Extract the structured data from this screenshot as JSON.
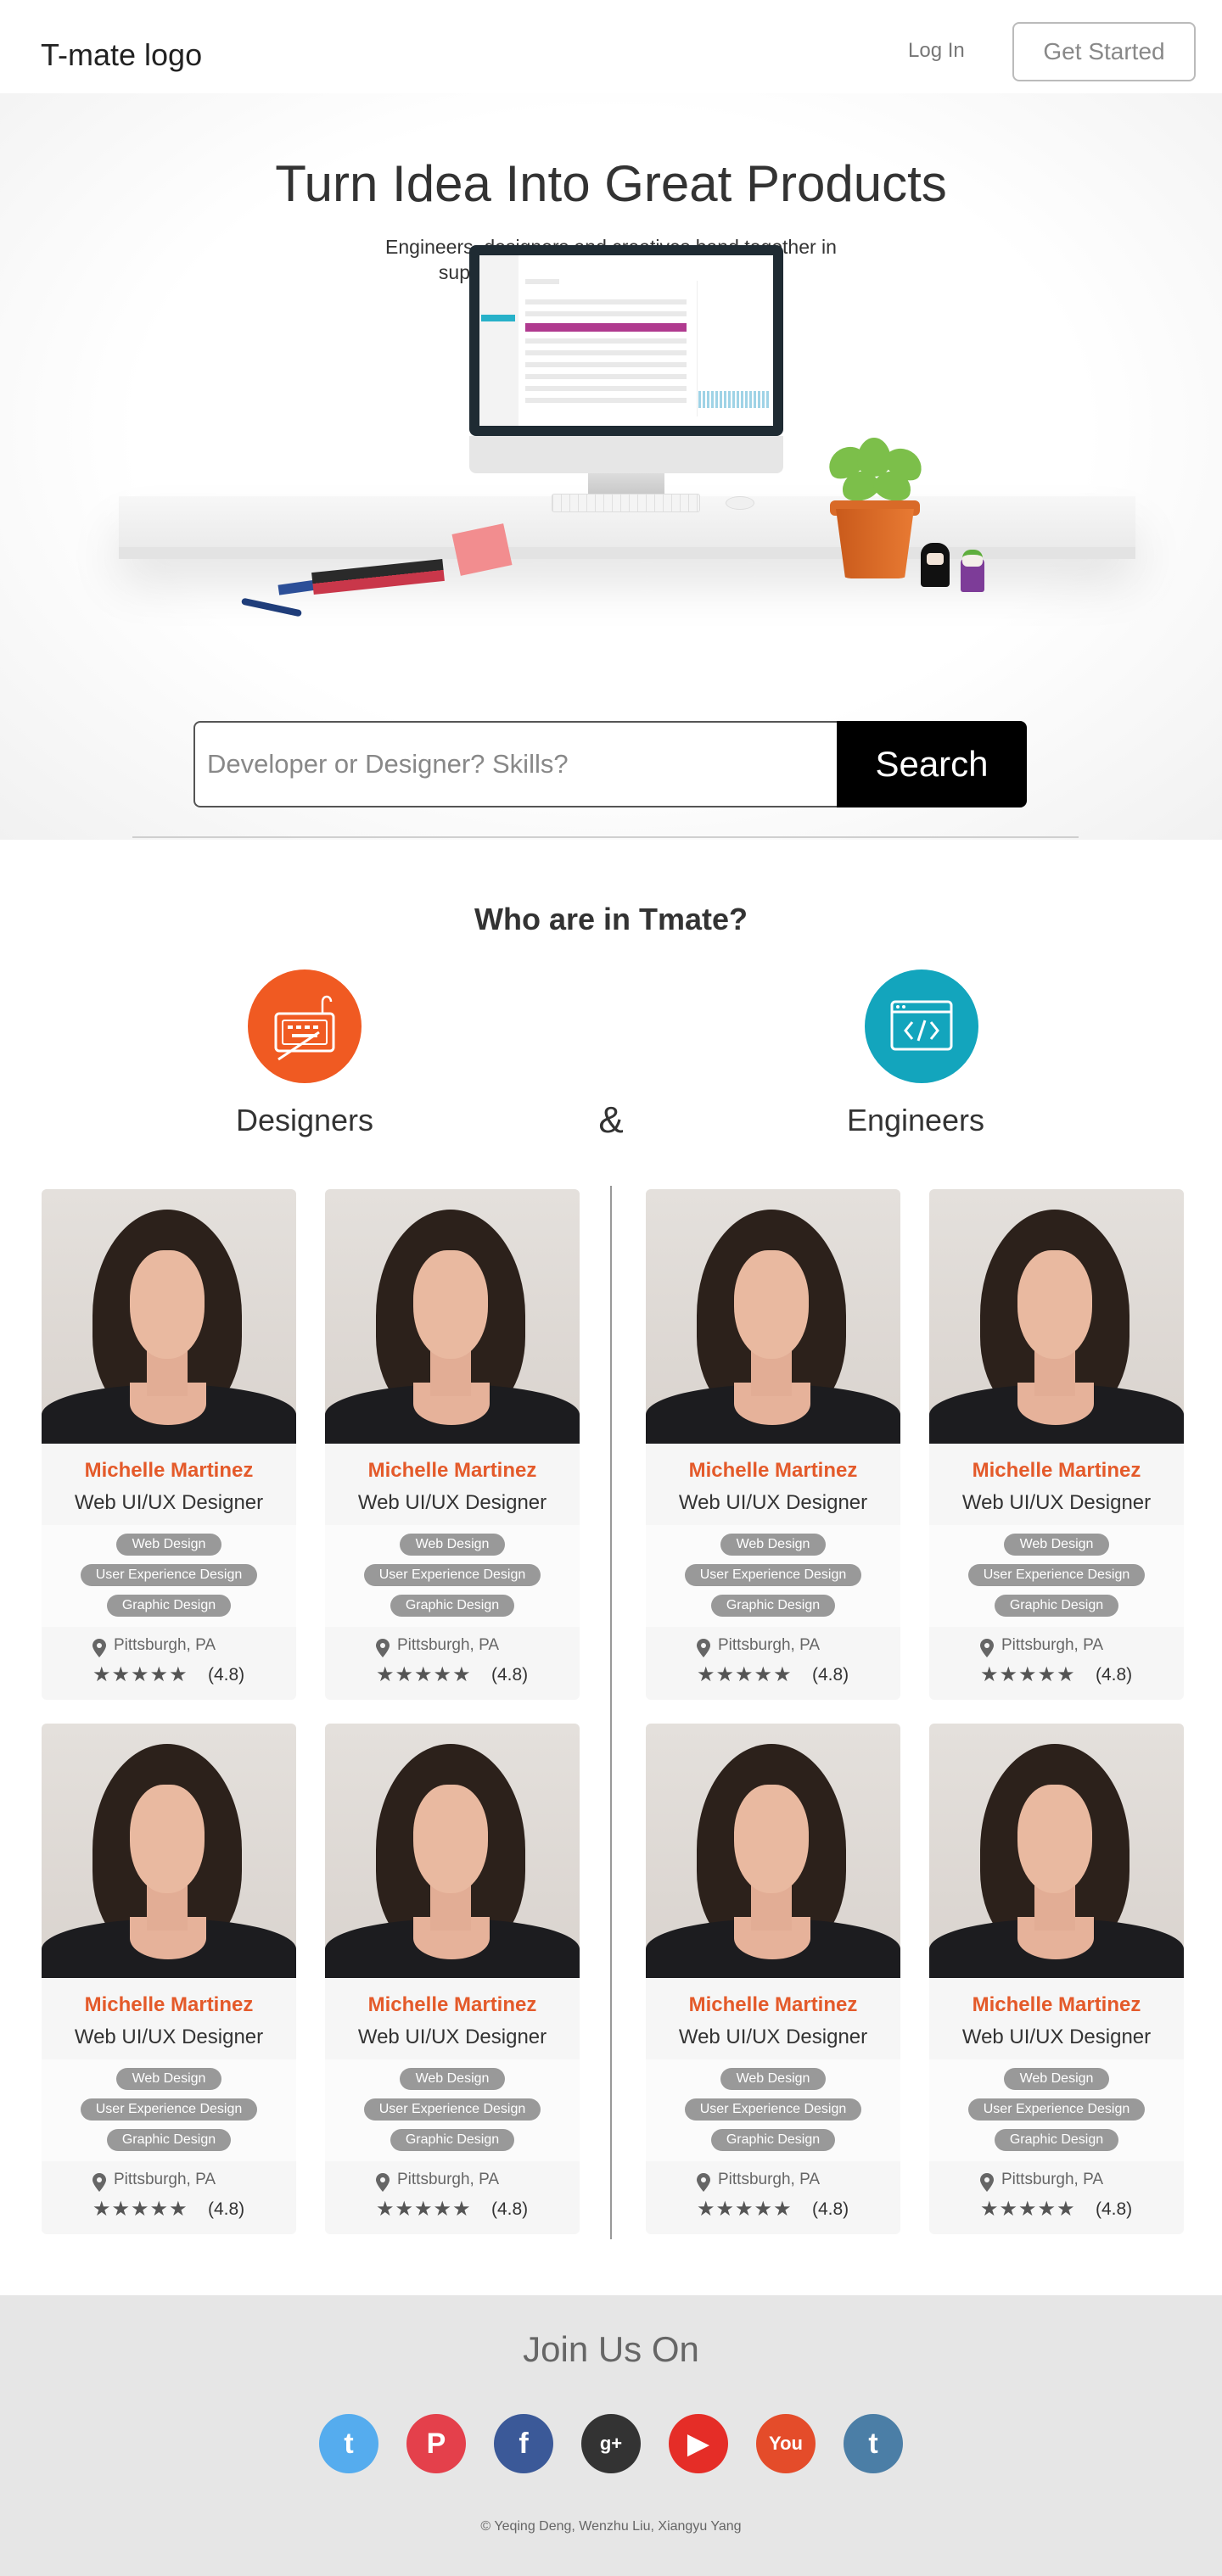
{
  "header": {
    "logo": "T-mate logo",
    "login": "Log In",
    "get_started": "Get Started"
  },
  "hero": {
    "title": "Turn Idea Into Great Products",
    "subtitle": "Engineers, designers and creatives band together in support of those ideas. Work gets done."
  },
  "search": {
    "placeholder": "Developer or Designer? Skills?",
    "button": "Search"
  },
  "who": {
    "title": "Who are in Tmate?",
    "designers_label": "Designers",
    "ampersand": "&",
    "engineers_label": "Engineers"
  },
  "cards": [
    {
      "group": "designers",
      "name": "Michelle Martinez",
      "title": "Web UI/UX Designer",
      "skills": [
        "Web Design",
        "User Experience Design",
        "Graphic Design"
      ],
      "location": "Pittsburgh, PA",
      "stars": "★★★★★",
      "rating": "(4.8)"
    },
    {
      "group": "designers",
      "name": "Michelle Martinez",
      "title": "Web UI/UX Designer",
      "skills": [
        "Web Design",
        "User Experience Design",
        "Graphic Design"
      ],
      "location": "Pittsburgh, PA",
      "stars": "★★★★★",
      "rating": "(4.8)"
    },
    {
      "group": "engineers",
      "name": "Michelle Martinez",
      "title": "Web UI/UX Designer",
      "skills": [
        "Web Design",
        "User Experience Design",
        "Graphic Design"
      ],
      "location": "Pittsburgh, PA",
      "stars": "★★★★★",
      "rating": "(4.8)"
    },
    {
      "group": "engineers",
      "name": "Michelle Martinez",
      "title": "Web UI/UX Designer",
      "skills": [
        "Web Design",
        "User Experience Design",
        "Graphic Design"
      ],
      "location": "Pittsburgh, PA",
      "stars": "★★★★★",
      "rating": "(4.8)"
    },
    {
      "group": "designers",
      "name": "Michelle Martinez",
      "title": "Web UI/UX Designer",
      "skills": [
        "Web Design",
        "User Experience Design",
        "Graphic Design"
      ],
      "location": "Pittsburgh, PA",
      "stars": "★★★★★",
      "rating": "(4.8)"
    },
    {
      "group": "designers",
      "name": "Michelle Martinez",
      "title": "Web UI/UX Designer",
      "skills": [
        "Web Design",
        "User Experience Design",
        "Graphic Design"
      ],
      "location": "Pittsburgh, PA",
      "stars": "★★★★★",
      "rating": "(4.8)"
    },
    {
      "group": "engineers",
      "name": "Michelle Martinez",
      "title": "Web UI/UX Designer",
      "skills": [
        "Web Design",
        "User Experience Design",
        "Graphic Design"
      ],
      "location": "Pittsburgh, PA",
      "stars": "★★★★★",
      "rating": "(4.8)"
    },
    {
      "group": "engineers",
      "name": "Michelle Martinez",
      "title": "Web UI/UX Designer",
      "skills": [
        "Web Design",
        "User Experience Design",
        "Graphic Design"
      ],
      "location": "Pittsburgh, PA",
      "stars": "★★★★★",
      "rating": "(4.8)"
    }
  ],
  "footer": {
    "title": "Join Us On",
    "socials": [
      {
        "icon": "twitter-icon",
        "glyph": "t",
        "color": "#55acee"
      },
      {
        "icon": "pinterest-icon",
        "glyph": "P",
        "color": "#e4404b"
      },
      {
        "icon": "facebook-icon",
        "glyph": "f",
        "color": "#3b5998"
      },
      {
        "icon": "google-plus-icon",
        "glyph": "g+",
        "color": "#333333"
      },
      {
        "icon": "youtube-icon",
        "glyph": "▶",
        "color": "#e52d27"
      },
      {
        "icon": "youtube-text-icon",
        "glyph": "You",
        "color": "#e44c2a"
      },
      {
        "icon": "tumblr-icon",
        "glyph": "t",
        "color": "#4b7ea6"
      }
    ],
    "copyright": "© Yeqing Deng, Wenzhu Liu, Xiangyu Yang"
  },
  "colors": {
    "accent_orange": "#f05a22",
    "accent_teal": "#13a5bd",
    "name_orange": "#e45a2a"
  }
}
